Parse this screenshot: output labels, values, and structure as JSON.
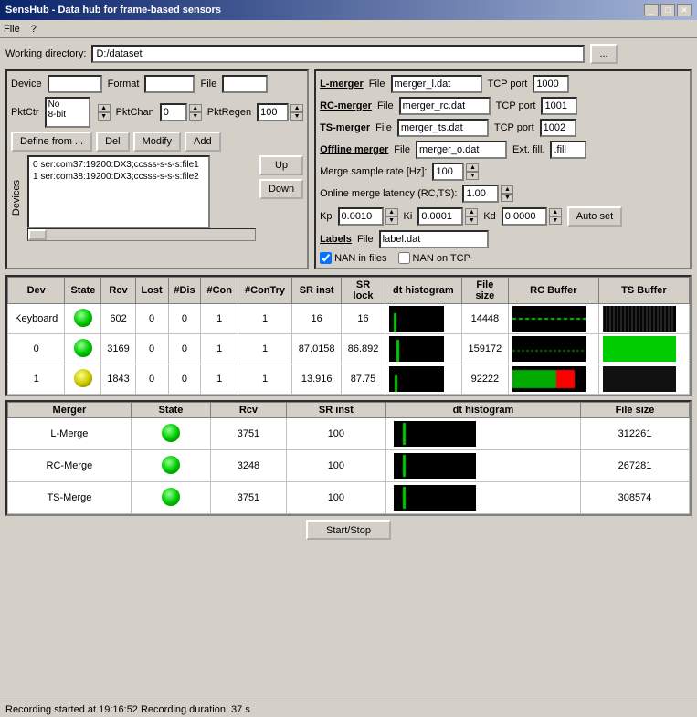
{
  "window": {
    "title": "SensHub - Data hub for frame-based sensors",
    "menu": [
      "File",
      "?"
    ]
  },
  "working_dir": {
    "label": "Working directory:",
    "value": "D:/dataset",
    "browse_btn": "..."
  },
  "device_config": {
    "device_label": "Device",
    "format_label": "Format",
    "file_label": "File",
    "pktctr_label": "PktCtr",
    "pktctr_value": "No\n8-bit",
    "pktchan_label": "PktChan",
    "pktchan_value": "0",
    "pktregen_label": "PktRegen",
    "pktregen_value": "100",
    "define_btn": "Define from ...",
    "del_btn": "Del",
    "modify_btn": "Modify",
    "add_btn": "Add",
    "devices_label": "Devices",
    "up_btn": "Up",
    "down_btn": "Down",
    "device_list": [
      "0 ser:com37:19200:DX3;ccsss-s-s-s:file1",
      "1 ser:com38:19200:DX3;ccsss-s-s-s:file2"
    ]
  },
  "mergers": {
    "l_merger": {
      "label": "L-merger",
      "file_label": "File",
      "file_value": "merger_l.dat",
      "tcp_port_label": "TCP port",
      "tcp_port_value": "1000"
    },
    "rc_merger": {
      "label": "RC-merger",
      "file_label": "File",
      "file_value": "merger_rc.dat",
      "tcp_port_label": "TCP port",
      "tcp_port_value": "1001"
    },
    "ts_merger": {
      "label": "TS-merger",
      "file_label": "File",
      "file_value": "merger_ts.dat",
      "tcp_port_label": "TCP port",
      "tcp_port_value": "1002"
    },
    "offline_merger": {
      "label": "Offline merger",
      "file_label": "File",
      "file_value": "merger_o.dat",
      "ext_fill_label": "Ext. fill.",
      "ext_fill_value": ".fill"
    },
    "merge_sample_rate_label": "Merge sample rate [Hz]:",
    "merge_sample_rate_value": "100",
    "online_merge_latency_label": "Online merge latency (RC,TS):",
    "online_merge_latency_value": "1.00",
    "kp_label": "Kp",
    "kp_value": "0.0010",
    "ki_label": "Ki",
    "ki_value": "0.0001",
    "kd_label": "Kd",
    "kd_value": "0.0000",
    "auto_set_btn": "Auto set",
    "labels_label": "Labels",
    "labels_file_label": "File",
    "labels_file_value": "label.dat",
    "nan_in_files_label": "NAN in files",
    "nan_in_files_checked": true,
    "nan_on_tcp_label": "NAN on TCP",
    "nan_on_tcp_checked": false
  },
  "device_table": {
    "headers": [
      "Dev",
      "State",
      "Rcv",
      "Lost",
      "#Dis",
      "#Con",
      "#ConTry",
      "SR inst",
      "SR\nlock",
      "dt histogram",
      "File\nsize",
      "RC Buffer",
      "TS Buffer"
    ],
    "rows": [
      {
        "dev": "Keyboard",
        "state": "green",
        "rcv": "602",
        "lost": "0",
        "dis": "0",
        "con": "1",
        "contry": "1",
        "sr_inst": "16",
        "sr_lock": "16",
        "file_size": "14448",
        "rc_type": "dashed_green",
        "ts_type": "pattern"
      },
      {
        "dev": "0",
        "state": "green",
        "rcv": "3169",
        "lost": "0",
        "dis": "0",
        "con": "1",
        "contry": "1",
        "sr_inst": "87.0158",
        "sr_lock": "86.892",
        "file_size": "159172",
        "rc_type": "dashed_green2",
        "ts_type": "solid_green"
      },
      {
        "dev": "1",
        "state": "yellow",
        "rcv": "1843",
        "lost": "0",
        "dis": "0",
        "con": "1",
        "contry": "1",
        "sr_inst": "13.916",
        "sr_lock": "87.75",
        "file_size": "92222",
        "rc_type": "red_partial",
        "ts_type": "dark"
      }
    ]
  },
  "merger_table": {
    "headers": [
      "Merger",
      "State",
      "Rcv",
      "SR inst",
      "dt histogram",
      "File size"
    ],
    "rows": [
      {
        "merger": "L-Merge",
        "state": "green",
        "rcv": "3751",
        "sr_inst": "100",
        "file_size": "312261"
      },
      {
        "merger": "RC-Merge",
        "state": "green",
        "rcv": "3248",
        "sr_inst": "100",
        "file_size": "267281"
      },
      {
        "merger": "TS-Merge",
        "state": "green",
        "rcv": "3751",
        "sr_inst": "100",
        "file_size": "308574"
      }
    ]
  },
  "controls": {
    "start_stop_btn": "Start/Stop"
  },
  "status_bar": {
    "text": "Recording started at 19:16:52  Recording duration: 37 s"
  }
}
